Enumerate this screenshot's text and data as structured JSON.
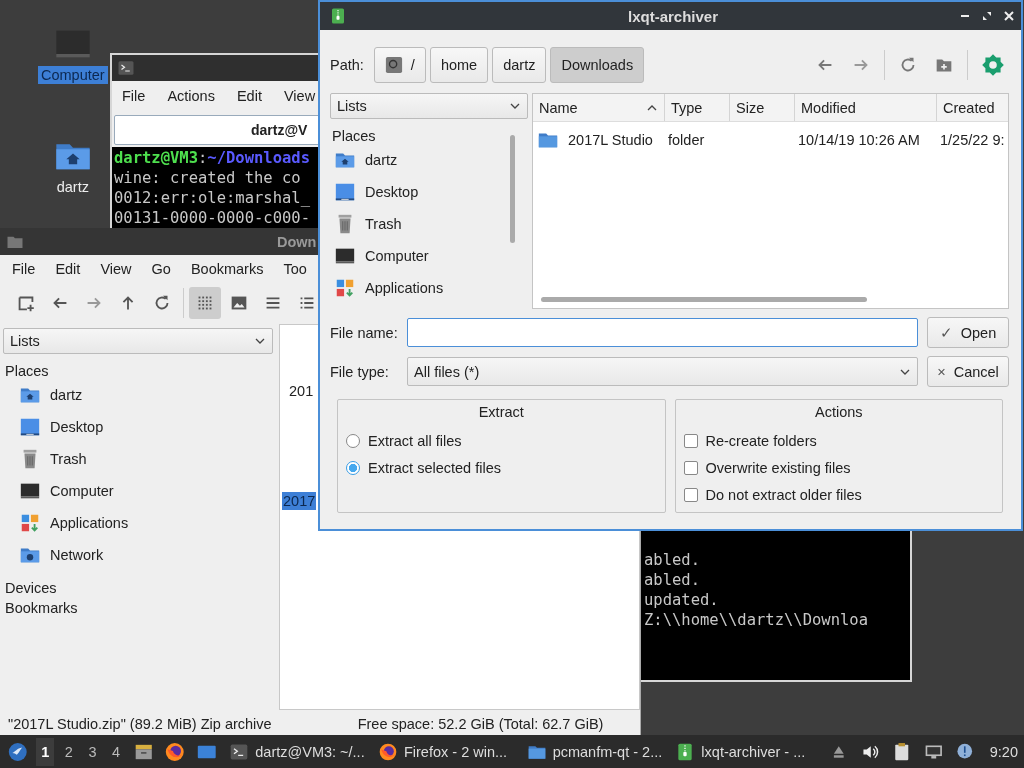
{
  "desktop_icons": [
    {
      "label": "Computer",
      "kind": "computer",
      "selected": true
    },
    {
      "label": "dartz",
      "kind": "home",
      "selected": false
    }
  ],
  "terminal": {
    "menu": [
      "File",
      "Actions",
      "Edit",
      "View"
    ],
    "tab_title": "dartz@V",
    "prompt": {
      "user": "dartz@VM3",
      "separator": ":",
      "path": "~/Downloads"
    },
    "lines": [
      "wine: created the co",
      "0012:err:ole:marshal_",
      "00131-0000-0000-c000-"
    ],
    "lower_lines": [
      "abled.",
      "abled.",
      "updated.",
      "Z:\\\\home\\\\dartz\\\\Downloa"
    ]
  },
  "file_manager": {
    "title": "Down",
    "menu": [
      "File",
      "Edit",
      "View",
      "Go",
      "Bookmarks",
      "Too"
    ],
    "view_buttons": [
      {
        "kind": "icons",
        "selected": true
      },
      {
        "kind": "thumbnails",
        "selected": false
      },
      {
        "kind": "compact",
        "selected": false
      },
      {
        "kind": "detailed",
        "selected": false
      }
    ],
    "sidebar": {
      "dropdown": "Lists",
      "sections": [
        {
          "title": "Places",
          "items": [
            {
              "label": "dartz",
              "kind": "home"
            },
            {
              "label": "Desktop",
              "kind": "desktop"
            },
            {
              "label": "Trash",
              "kind": "trash"
            },
            {
              "label": "Computer",
              "kind": "computer"
            },
            {
              "label": "Applications",
              "kind": "applications"
            },
            {
              "label": "Network",
              "kind": "network"
            }
          ]
        },
        {
          "title": "Devices"
        },
        {
          "title": "Bookmarks"
        }
      ]
    },
    "files": [
      {
        "label": "201",
        "selected": false
      },
      {
        "label": "2017",
        "selected": true
      }
    ],
    "status": {
      "selection": "\"2017L Studio.zip\" (89.2 MiB) Zip archive",
      "free_space": "Free space: 52.2 GiB (Total: 62.7 GiB)"
    }
  },
  "dialog": {
    "title": "lxqt-archiver",
    "path_label": "Path:",
    "crumbs": [
      {
        "label": "/",
        "kind": "root",
        "selected": false
      },
      {
        "label": "home",
        "kind": "dir",
        "selected": false
      },
      {
        "label": "dartz",
        "kind": "dir",
        "selected": false
      },
      {
        "label": "Downloads",
        "kind": "dir",
        "selected": true
      }
    ],
    "places": {
      "dropdown": "Lists",
      "heading": "Places",
      "items": [
        {
          "label": "dartz",
          "kind": "home"
        },
        {
          "label": "Desktop",
          "kind": "desktop"
        },
        {
          "label": "Trash",
          "kind": "trash"
        },
        {
          "label": "Computer",
          "kind": "computer"
        },
        {
          "label": "Applications",
          "kind": "applications"
        }
      ]
    },
    "table": {
      "columns": [
        {
          "label": "Name",
          "sorted": true
        },
        {
          "label": "Type",
          "sorted": false
        },
        {
          "label": "Size",
          "sorted": false
        },
        {
          "label": "Modified",
          "sorted": false
        },
        {
          "label": "Created",
          "sorted": false
        }
      ],
      "rows": [
        {
          "name": "2017L Studio",
          "type": "folder",
          "modified": "10/14/19 10:26 AM",
          "created": "1/25/22 9:"
        }
      ]
    },
    "file_name": {
      "label": "File name:"
    },
    "file_type": {
      "label": "File type:",
      "value": "All files (*)"
    },
    "buttons": [
      {
        "label": "Open",
        "icon": "✓"
      },
      {
        "label": "Cancel",
        "icon": "×"
      }
    ],
    "extract": {
      "title": "Extract",
      "options": [
        {
          "label": "Extract all files",
          "selected": false
        },
        {
          "label": "Extract selected files",
          "selected": true
        }
      ]
    },
    "actions": {
      "title": "Actions",
      "options": [
        {
          "label": "Re-create folders",
          "checked": false
        },
        {
          "label": "Overwrite existing files",
          "checked": false
        },
        {
          "label": "Do not extract older files",
          "checked": false
        }
      ]
    }
  },
  "taskbar": {
    "workspaces": [
      {
        "label": "1",
        "selected": true
      },
      {
        "label": "2",
        "selected": false
      },
      {
        "label": "3",
        "selected": false
      },
      {
        "label": "4",
        "selected": false
      }
    ],
    "tasks": [
      {
        "label": "dartz@VM3: ~/...",
        "kind": "terminal"
      },
      {
        "label": "Firefox - 2 win...",
        "kind": "firefox"
      },
      {
        "label": "pcmanfm-qt - 2...",
        "kind": "folder"
      },
      {
        "label": "lxqt-archiver - ...",
        "kind": "archiver"
      }
    ],
    "clock": "9:20"
  }
}
